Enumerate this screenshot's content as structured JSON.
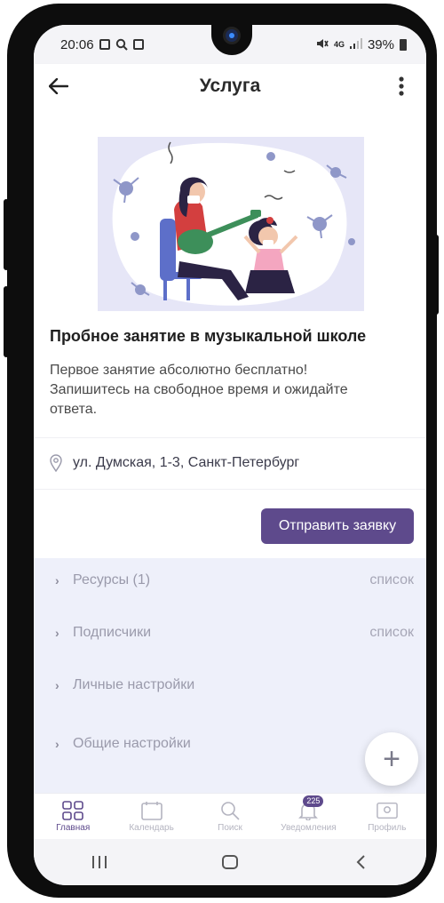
{
  "status_bar": {
    "time": "20:06",
    "left_icons": [
      "image-icon",
      "search-icon",
      "record-icon"
    ],
    "right_icons": [
      "mute-icon",
      "signal-4g-icon",
      "signal-bars-icon",
      "battery-icon"
    ],
    "network": "4G",
    "battery": "39%"
  },
  "app_bar": {
    "title": "Услуга",
    "back_icon": "arrow-left-icon",
    "more_icon": "more-vertical-icon"
  },
  "service": {
    "illustration": "music-lesson-illustration",
    "title": "Пробное занятие в музыкальной школе",
    "description": "Первое занятие абсолютно бесплатно! Запишитесь на свободное время и ожидайте ответа.",
    "address": "ул. Думская, 1-3, Санкт-Петербург",
    "submit_label": "Отправить заявку"
  },
  "sections": [
    {
      "label": "Ресурсы (1)",
      "right": "список"
    },
    {
      "label": "Подписчики",
      "right": "список"
    },
    {
      "label": "Личные настройки",
      "right": ""
    },
    {
      "label": "Общие настройки",
      "right": ""
    }
  ],
  "fab": {
    "label": "+"
  },
  "bottom_nav": [
    {
      "label": "Главная",
      "icon": "grid-icon",
      "active": true
    },
    {
      "label": "Календарь",
      "icon": "calendar-icon",
      "active": false
    },
    {
      "label": "Поиск",
      "icon": "search-icon",
      "active": false
    },
    {
      "label": "Уведомления",
      "icon": "bell-icon",
      "active": false,
      "badge": "225"
    },
    {
      "label": "Профиль",
      "icon": "profile-card-icon",
      "active": false
    }
  ],
  "system_nav": [
    "recent-apps-icon",
    "home-icon",
    "back-icon"
  ],
  "colors": {
    "accent": "#5e4a8c",
    "sections_bg": "#eef0fa",
    "illustration_bg": "#e6e6f7"
  }
}
